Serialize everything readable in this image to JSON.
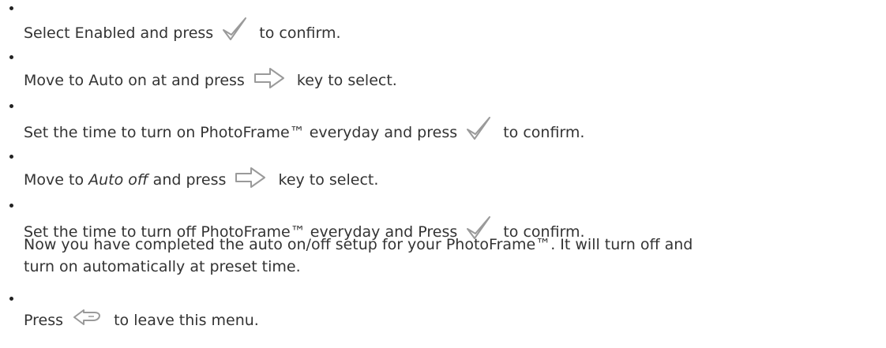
{
  "steps": [
    {
      "before": "Select Enabled and press",
      "icon": "check-icon",
      "after": "to confirm."
    },
    {
      "before": "Move to Auto on at and press",
      "icon": "right-arrow-icon",
      "after": "key to select."
    },
    {
      "before": "Set the time to turn on PhotoFrame™ everyday and press",
      "icon": "check-icon",
      "after": "to confirm."
    },
    {
      "before": "Move to",
      "italic": "Auto off",
      "before2": "and press",
      "icon": "right-arrow-icon",
      "after": "key to select."
    },
    {
      "before": "Set the time to turn off PhotoFrame™ everyday and Press",
      "icon": "check-icon",
      "after": "to confirm.",
      "note_line1": "Now you have completed the auto on/off setup for your PhotoFrame™. It will turn off and",
      "note_line2": "turn on automatically at preset time."
    },
    {
      "before": "Press",
      "icon": "back-icon",
      "after": "to leave this menu."
    }
  ],
  "colors": {
    "text": "#333333",
    "icon": "#9a9a9a"
  }
}
